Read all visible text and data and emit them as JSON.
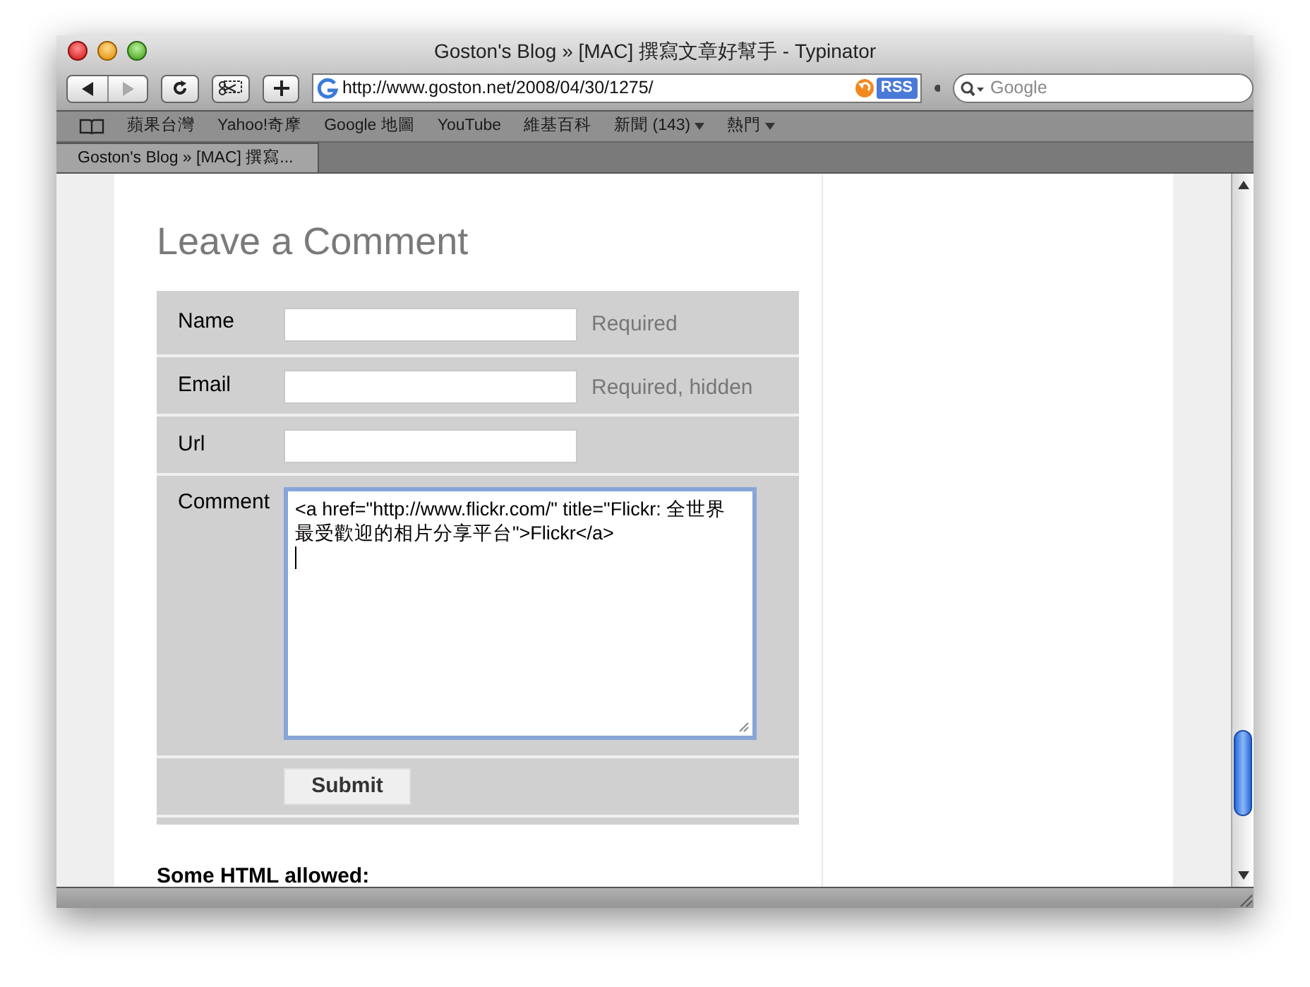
{
  "window": {
    "title": "Goston's Blog » [MAC] 撰寫文章好幫手 - Typinator"
  },
  "toolbar": {
    "url": "http://www.goston.net/2008/04/30/1275/",
    "rss": "RSS",
    "search": {
      "placeholder": "Google"
    }
  },
  "bookmarks": [
    {
      "label": "蘋果台灣",
      "has_menu": false
    },
    {
      "label": "Yahoo!奇摩",
      "has_menu": false
    },
    {
      "label": "Google 地圖",
      "has_menu": false
    },
    {
      "label": "YouTube",
      "has_menu": false
    },
    {
      "label": "維基百科",
      "has_menu": false
    },
    {
      "label": "新聞 (143)",
      "has_menu": true
    },
    {
      "label": "熱門",
      "has_menu": true
    }
  ],
  "tabs": [
    {
      "label": "Goston's Blog » [MAC] 撰寫...",
      "selected": true
    }
  ],
  "page": {
    "heading": "Leave a Comment",
    "fields": [
      {
        "kind": "input",
        "label": "Name",
        "hint": "Required"
      },
      {
        "kind": "input",
        "label": "Email",
        "hint": "Required, hidden"
      },
      {
        "kind": "input",
        "label": "Url"
      },
      {
        "kind": "textarea",
        "label": "Comment",
        "value": "<a href=\"http://www.flickr.com/\" title=\"Flickr: 全世界最受歡迎的相片分享平台\">Flickr</a>",
        "focused": true
      }
    ],
    "submit": "Submit",
    "note": "Some HTML allowed:"
  }
}
